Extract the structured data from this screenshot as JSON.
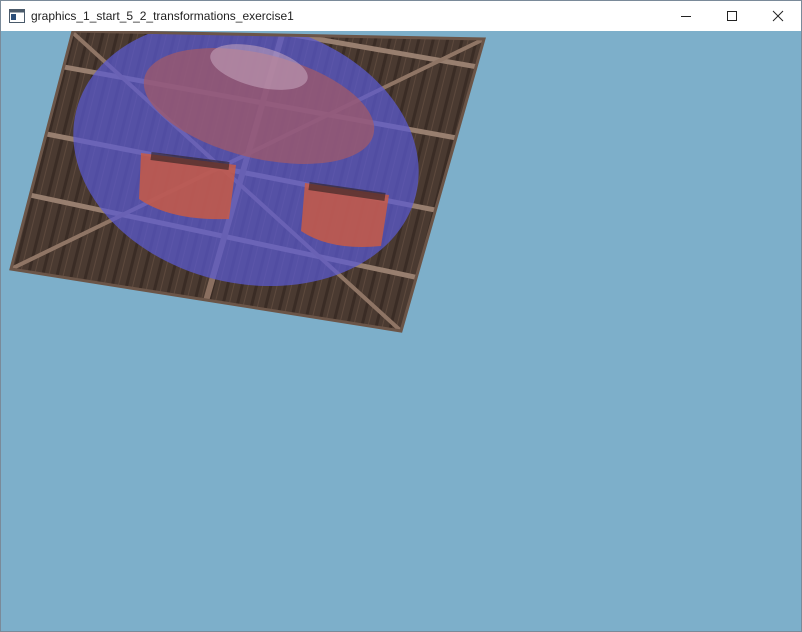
{
  "window": {
    "title": "graphics_1_start_5_2_transformations_exercise1",
    "clear_color": "#7dafca",
    "controls": {
      "minimize_icon": "minimize-icon",
      "maximize_icon": "maximize-icon",
      "close_icon": "close-icon"
    }
  },
  "scene": {
    "object": "textured-quad",
    "textures": [
      "wooden-container",
      "awesomeface"
    ],
    "colors": {
      "wood_dark": "#3e2f27",
      "wood_plank": "#5a463b",
      "wood_beam": "#8b6f60",
      "face_blue": "#5050c8",
      "face_red": "#c85a45"
    }
  }
}
